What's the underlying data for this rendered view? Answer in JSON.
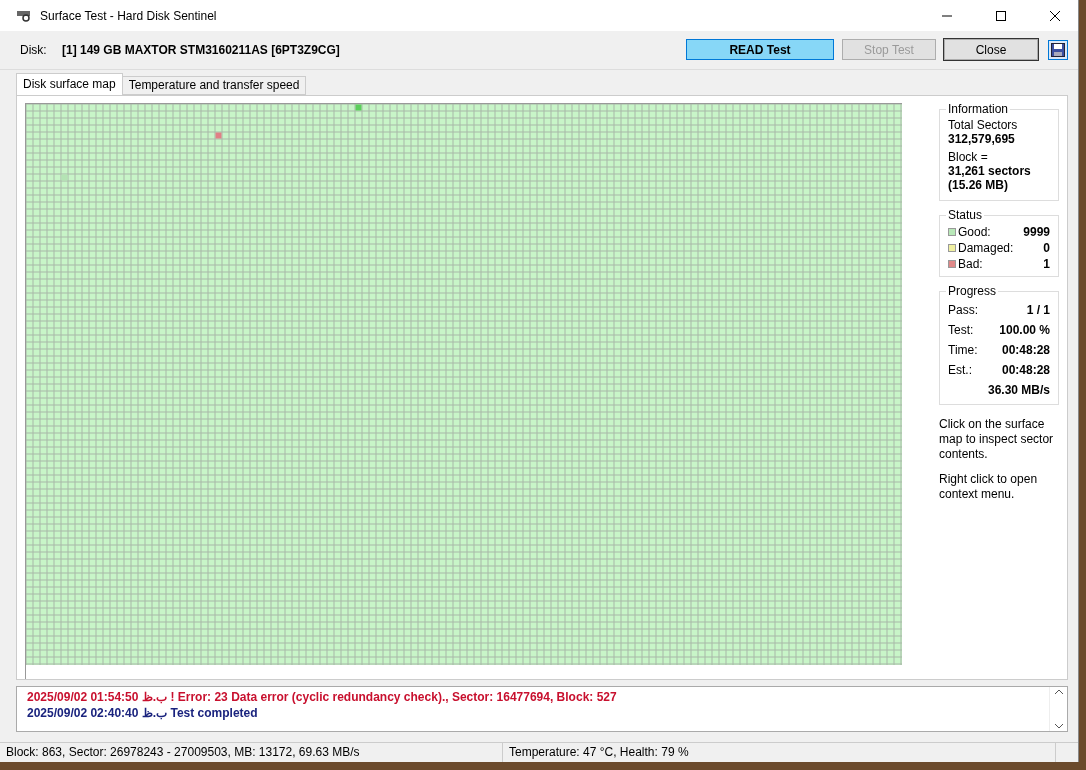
{
  "window": {
    "title": "Surface Test - Hard Disk Sentinel"
  },
  "disk": {
    "label": "Disk:",
    "value": "[1] 149 GB  MAXTOR STM3160211AS [6PT3Z9CG]"
  },
  "buttons": [
    {
      "label": "READ Test",
      "kind": "active",
      "disabled": false
    },
    {
      "label": "Stop Test",
      "kind": "normal",
      "disabled": true
    },
    {
      "label": "Close",
      "kind": "normal",
      "disabled": false
    }
  ],
  "tabs": [
    {
      "label": "Disk surface map",
      "selected": true
    },
    {
      "label": "Temperature and transfer speed",
      "selected": false
    }
  ],
  "information": {
    "title": "Information",
    "rows": [
      {
        "label": "Total Sectors",
        "value": "312,579,695"
      },
      {
        "label": "Block =",
        "value": "31,261 sectors (15.26 MB)"
      }
    ]
  },
  "status": {
    "title": "Status",
    "items": [
      {
        "label": "Good:",
        "value": "9999",
        "color": "#b8e8b8"
      },
      {
        "label": "Damaged:",
        "value": "0",
        "color": "#f0f0a0"
      },
      {
        "label": "Bad:",
        "value": "1",
        "color": "#e08888"
      }
    ]
  },
  "progress": {
    "title": "Progress",
    "rows": [
      {
        "label": "Pass:",
        "value": "1 / 1"
      },
      {
        "label": "Test:",
        "value": "100.00 %"
      },
      {
        "label": "Time:",
        "value": "00:48:28"
      },
      {
        "label": "Est.:",
        "value": "00:48:28"
      },
      {
        "label": "",
        "value": "36.30 MB/s"
      }
    ]
  },
  "help": [
    "Click on the surface map to inspect sector contents.",
    "Right click to open context menu."
  ],
  "log": [
    {
      "kind": "error",
      "text": "2025/09/02  01:54:50 ب.ظ ! Error: 23 Data error (cyclic redundancy check)., Sector: 16477694, Block: 527"
    },
    {
      "kind": "info",
      "text": "2025/09/02  02:40:40 ب.ظ   Test completed"
    }
  ],
  "status_bar": [
    "Block: 863, Sector: 26978243 - 27009503, MB: 13172, 69.63 MB/s",
    "Temperature: 47  °C,  Health: 79 %"
  ]
}
